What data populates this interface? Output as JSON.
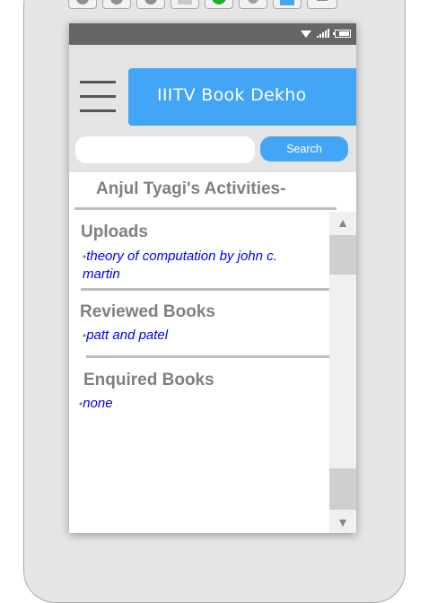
{
  "header": {
    "app_title": "IIITV Book Dekho"
  },
  "search": {
    "placeholder": "",
    "button_label": "Search"
  },
  "activities": {
    "title": "Anjul Tyagi's Activities-"
  },
  "sections": {
    "uploads": {
      "title": "Uploads",
      "items": [
        "theory of computation by john c. martin"
      ]
    },
    "reviewed": {
      "title": "Reviewed Books",
      "items": [
        "patt and patel"
      ]
    },
    "enquired": {
      "title": "Enquired Books",
      "items": [
        "none"
      ]
    }
  },
  "scrollbar": {
    "up_glyph": "▲",
    "down_glyph": "▼"
  },
  "bullet": "•",
  "colors": {
    "accent": "#42a5f5",
    "statusbar": "#666666",
    "link": "#0000ee",
    "section_text": "#808080"
  }
}
